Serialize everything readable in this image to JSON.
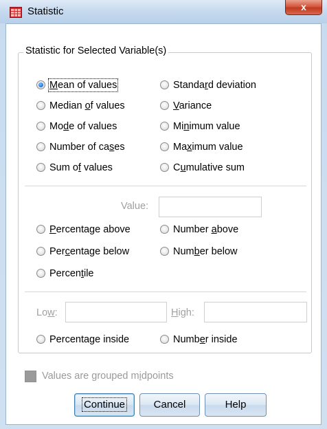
{
  "window": {
    "title": "Statistic",
    "close_glyph": "x"
  },
  "group": {
    "title": "Statistic for Selected Variable(s)",
    "options": [
      {
        "pre": "",
        "u": "M",
        "post": "ean of values",
        "checked": true
      },
      {
        "pre": "Median ",
        "u": "o",
        "post": "f values",
        "checked": false
      },
      {
        "pre": "Mo",
        "u": "d",
        "post": "e of values",
        "checked": false
      },
      {
        "pre": "Number of ca",
        "u": "s",
        "post": "es",
        "checked": false
      },
      {
        "pre": "Sum o",
        "u": "f",
        "post": " values",
        "checked": false
      },
      {
        "pre": "Standa",
        "u": "r",
        "post": "d deviation",
        "checked": false
      },
      {
        "pre": "",
        "u": "V",
        "post": "ariance",
        "checked": false
      },
      {
        "pre": "Mi",
        "u": "n",
        "post": "imum value",
        "checked": false
      },
      {
        "pre": "Ma",
        "u": "x",
        "post": "imum value",
        "checked": false
      },
      {
        "pre": "C",
        "u": "u",
        "post": "mulative sum",
        "checked": false
      }
    ],
    "value_label": {
      "text": "Value:"
    },
    "value_field": "",
    "value_options": [
      {
        "pre": "",
        "u": "P",
        "post": "ercentage above"
      },
      {
        "pre": "Number ",
        "u": "a",
        "post": "bove"
      },
      {
        "pre": "Per",
        "u": "c",
        "post": "entage below"
      },
      {
        "pre": "Num",
        "u": "b",
        "post": "er below"
      },
      {
        "pre": "Percen",
        "u": "t",
        "post": "ile"
      }
    ],
    "low_label": {
      "pre": "Lo",
      "u": "w",
      "post": ":"
    },
    "high_label": {
      "pre": "",
      "u": "H",
      "post": "igh:"
    },
    "low_field": "",
    "high_field": "",
    "range_options": [
      {
        "pre": "Percenta",
        "u": "g",
        "post": "e inside"
      },
      {
        "pre": "Numb",
        "u": "e",
        "post": "r inside"
      }
    ]
  },
  "grouped": {
    "pre": "Values are grouped m",
    "u": "i",
    "post": "dpoints",
    "checked": false
  },
  "buttons": {
    "continue": "Continue",
    "cancel": "Cancel",
    "help": "Help"
  }
}
